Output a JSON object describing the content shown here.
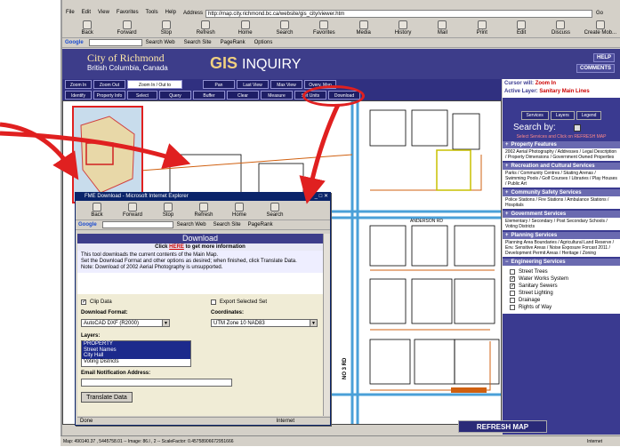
{
  "browser": {
    "menu": [
      "File",
      "Edit",
      "View",
      "Favorites",
      "Tools",
      "Help"
    ],
    "address_label": "Address",
    "url": "http://map.city.richmond.bc.ca/website/gis_city/viewer.htm",
    "go_label": "Go",
    "toolbar": [
      "Back",
      "Forward",
      "Stop",
      "Refresh",
      "Home",
      "Search",
      "Favorites",
      "Media",
      "History",
      "Mail",
      "Print",
      "Edit",
      "Discuss",
      "Create Mob..."
    ],
    "google": {
      "logo": "Google",
      "items": [
        "Search Web",
        "Search Site",
        "PageRank",
        "Options"
      ]
    }
  },
  "header": {
    "city": "City of Richmond",
    "province": "British Columbia, Canada",
    "gis_bold": "GIS",
    "gis_rest": "INQUIRY",
    "help": "HELP",
    "comments": "COMMENTS"
  },
  "tools": {
    "row1": [
      "Zoom In",
      "Zoom Out",
      "Zoom In / Out to",
      "Pan",
      "Last View",
      "Max View",
      "Overv. Map"
    ],
    "row2": [
      "Identify",
      "Property Info",
      "Select",
      "Query",
      "Buffer",
      "Clear",
      "Measure",
      "Set Units",
      "Download"
    ]
  },
  "panel": {
    "cursor_label": "Cursor will:",
    "cursor_value": "Zoom In",
    "active_label": "Active Layer:",
    "active_value": "Sanitary Main Lines",
    "tabs": [
      "Services",
      "Layers",
      "Legend"
    ],
    "search_by": "Search by:",
    "note": "Select Services and Click on REFRESH MAP",
    "sections": [
      {
        "title": "Property Features",
        "body": "2002 Aerial Photography / Addresses / Legal Description / Property Dimensions / Government Owned Properties"
      },
      {
        "title": "Recreation and Cultural Services",
        "body": "Parks / Community Centres / Skating Arenas / Swimming Pools / Golf Courses / Libraries / Play Houses / Public Art"
      },
      {
        "title": "Community Safety Services",
        "body": "Police Stations / Fire Stations / Ambulance Stations / Hospitals"
      },
      {
        "title": "Government Services",
        "body": "Elementary / Secondary / Post Secondary Schools / Voting Districts"
      },
      {
        "title": "Planning Services",
        "body": "Planning Area Boundaries / Agricultural Land Reserve / Env. Sensitive Areas / Noise Exposure Forcast 2011 / Development Permit Areas / Heritage / Zoning"
      },
      {
        "title": "Engineering Services",
        "body": ""
      }
    ],
    "engineering": [
      {
        "label": "Street Trees",
        "checked": false
      },
      {
        "label": "Water Works System",
        "checked": true
      },
      {
        "label": "Sanitary Sewers",
        "checked": true
      },
      {
        "label": "Street Lighting",
        "checked": false
      },
      {
        "label": "Drainage",
        "checked": false
      },
      {
        "label": "Rights of Way",
        "checked": false
      }
    ],
    "refresh": "REFRESH MAP"
  },
  "map": {
    "road1": "ANDERSON RD",
    "road2": "NO 3 RD"
  },
  "popup": {
    "title": "FME Download - Microsoft Internet Explorer",
    "toolbar": [
      "Back",
      "Forward",
      "Stop",
      "Refresh",
      "Home",
      "Search"
    ],
    "google": {
      "logo": "Google",
      "items": [
        "Search Web",
        "Search Site",
        "PageRank"
      ]
    },
    "heading": "Download",
    "click_pre": "Click ",
    "click_link": "HERE",
    "click_post": " to get more information",
    "desc1": "This tool downloads the current contents of the Main Map.",
    "desc2": "Set the Download Format and other options as desired; when finished, click Translate Data.",
    "desc3": "Note: Download of 2002 Aerial Photography is unsupported.",
    "clip_label": "Clip Data",
    "export_label": "Export Selected Set",
    "format_label": "Download Format:",
    "format_value": "AutoCAD DXF (R2000)",
    "coord_label": "Coordinates:",
    "coord_value": "UTM Zone 10 NAD83",
    "layers_label": "Layers:",
    "layers": [
      "PROPERTY",
      "Street Names",
      "City Hall",
      "Voting Districts"
    ],
    "email_label": "Email Notification Address:",
    "button": "Translate Data",
    "status_done": "Done",
    "status_zone": "Internet"
  },
  "status": {
    "text": "Map: 490140.37 , 5445758.01 -- Image: 86.l , 2 -- ScaleFactor: 0.45758906672951666",
    "zone": "Internet"
  },
  "colors": {
    "header": "#3d3d8a",
    "arrow": "#e02020",
    "road": "#4aa0d8",
    "sewer": "#d06010"
  }
}
